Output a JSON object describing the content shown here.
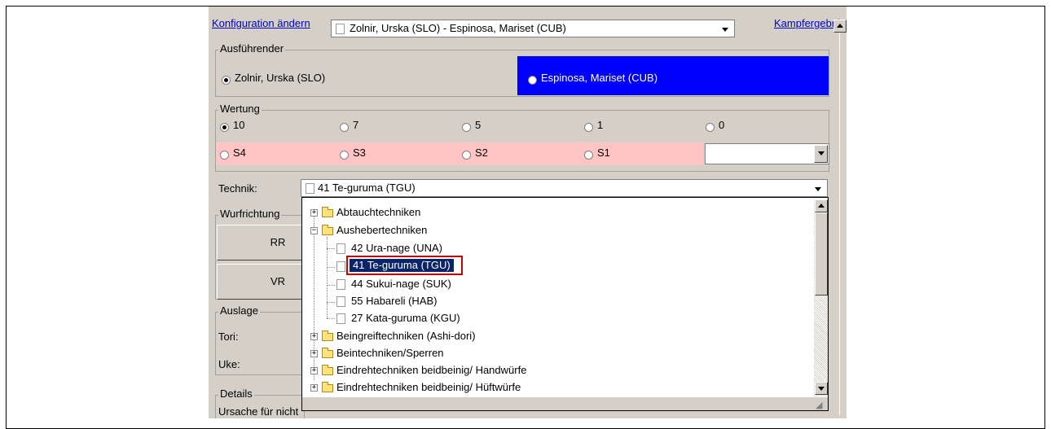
{
  "header": {
    "config_link": "Konfiguration ändern",
    "fight_select_value": "Zolnir, Urska (SLO) - Espinosa, Mariset (CUB)",
    "result_link": "Kampfergebnis"
  },
  "performer": {
    "title": "Ausführender",
    "option_1": "Zolnir, Urska (SLO)",
    "option_2": "Espinosa, Mariset (CUB)",
    "selected": "Zolnir, Urska (SLO)",
    "option_2_color": "#0000ff"
  },
  "score": {
    "title": "Wertung",
    "row1": [
      "10",
      "7",
      "5",
      "1",
      "0"
    ],
    "row2": [
      "S4",
      "S3",
      "S2",
      "S1"
    ],
    "selected": "10",
    "penalty_color": "#ffc4c4"
  },
  "technique": {
    "label": "Technik:",
    "value": "41 Te-guruma (TGU)",
    "tree": [
      {
        "label": "Abtauchtechniken",
        "expanded": false
      },
      {
        "label": "Aushebertechniken",
        "expanded": true,
        "children": [
          "42 Ura-nage (UNA)",
          "41 Te-guruma (TGU)",
          "44 Sukui-nage (SUK)",
          "55 Habareli (HAB)",
          "27 Kata-guruma (KGU)"
        ]
      },
      {
        "label": "Beingreiftechniken (Ashi-dori)",
        "expanded": false
      },
      {
        "label": "Beintechniken/Sperren",
        "expanded": false
      },
      {
        "label": "Eindrehtechniken beidbeinig/ Handwürfe",
        "expanded": false
      },
      {
        "label": "Eindrehtechniken beidbeinig/ Hüftwürfe",
        "expanded": false
      }
    ],
    "selected_item": "41 Te-guruma (TGU)",
    "highlight_color": "#cc0000"
  },
  "direction": {
    "title": "Wurfrichtung",
    "buttons": [
      "RR",
      "VR"
    ]
  },
  "stance": {
    "title": "Auslage",
    "tori_label": "Tori:",
    "uke_label": "Uke:"
  },
  "details": {
    "title": "Details",
    "cause_label_visible": "Ursache für nicht"
  }
}
